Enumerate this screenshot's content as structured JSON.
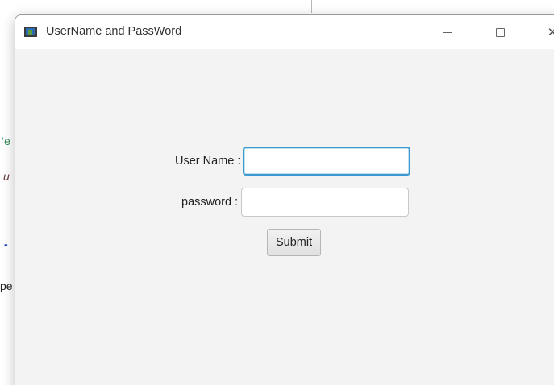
{
  "background": {
    "fragments": [
      {
        "text": "‘e",
        "color": "#2e8b57"
      },
      {
        "text": "u",
        "color": "#6b3a3a"
      },
      {
        "text": "-",
        "color": "#1f3fbf"
      },
      {
        "text": "pe",
        "color": "#222222"
      }
    ]
  },
  "window": {
    "title": "UserName and PassWord",
    "icon": "java-app-icon",
    "controls": {
      "minimize_icon": "minimize-icon",
      "maximize_icon": "maximize-icon",
      "close_glyph": "✕"
    }
  },
  "form": {
    "username_label": "User Name :",
    "username_value": "",
    "password_label": "password :",
    "password_value": "",
    "submit_label": "Submit"
  },
  "colors": {
    "focus_border": "#3d9ad1",
    "window_background": "#f3f3f3",
    "titlebar_background": "#ffffff"
  }
}
